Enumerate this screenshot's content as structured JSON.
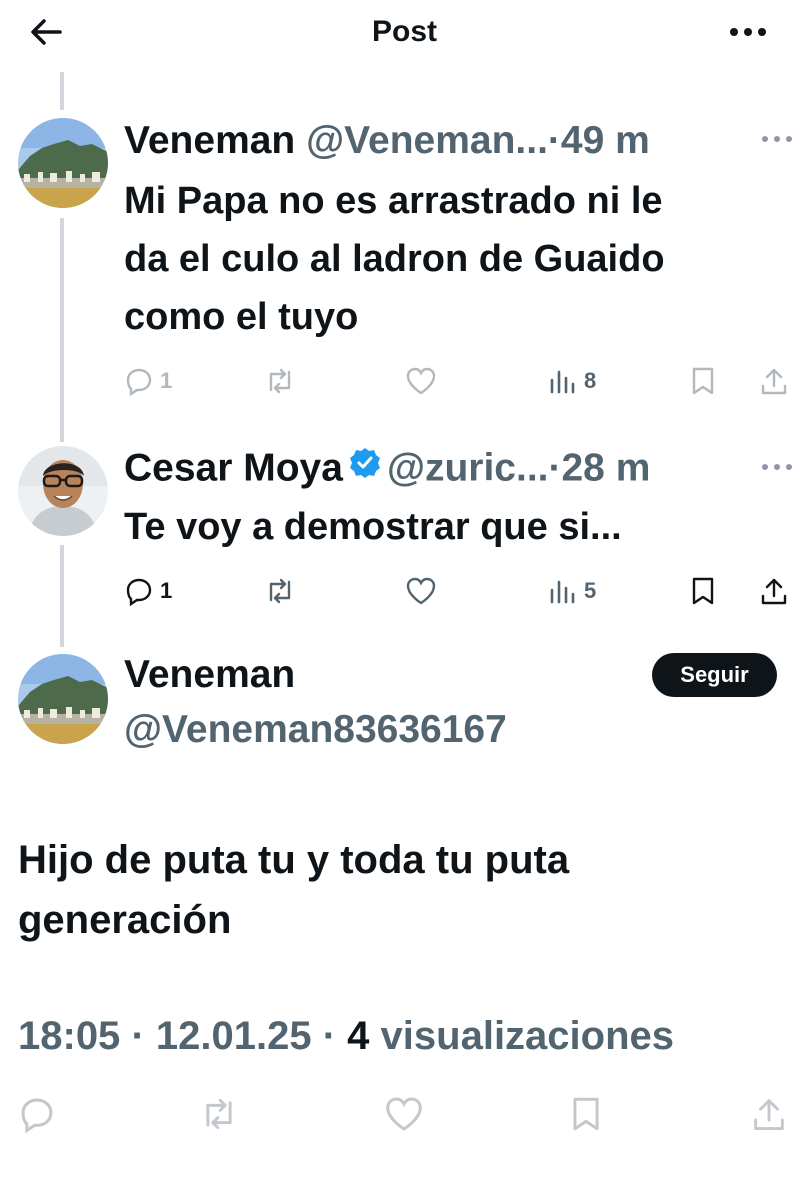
{
  "header": {
    "title": "Post",
    "back_icon": "arrow-left-icon",
    "more_icon": "ellipsis-icon"
  },
  "replies": [
    {
      "name": "Veneman",
      "handle": "@Veneman...",
      "time": "·49 m",
      "text_lines": [
        "Mi Papa no es arrastrado ni le",
        "da el culo al ladron de Guaido",
        "como el tuyo"
      ],
      "reply_count": "1",
      "views": "8"
    },
    {
      "name": "Cesar Moya",
      "handle": "@zuric...",
      "time": "·28 m",
      "verified": true,
      "text_lines": [
        "Te voy a demostrar que si..."
      ],
      "reply_count": "1",
      "views": "5"
    }
  ],
  "main_post": {
    "name": "Veneman",
    "handle": "@Veneman83636167",
    "follow_label": "Seguir",
    "text_lines": [
      "Hijo de puta tu y toda tu puta",
      "generación"
    ],
    "time": "18:05",
    "date": "12.01.25",
    "sep": "·",
    "views_count": "4",
    "views_label": "visualizaciones"
  },
  "colors": {
    "text": "#0f1419",
    "secondary": "#536471",
    "verified": "#1d9bf0",
    "thread_line": "#d0d6db"
  }
}
